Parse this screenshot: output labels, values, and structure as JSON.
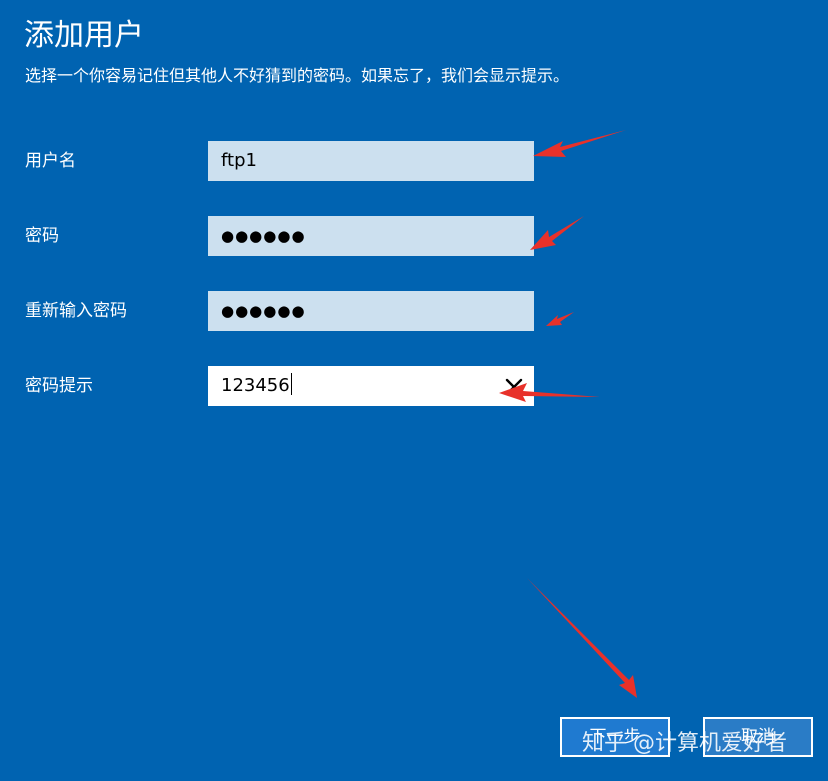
{
  "page": {
    "title": "添加用户",
    "subtitle": "选择一个你容易记住但其他人不好猜到的密码。如果忘了，我们会显示提示。"
  },
  "form": {
    "username": {
      "label": "用户名",
      "value": "ftp1"
    },
    "password": {
      "label": "密码",
      "value": "●●●●●●"
    },
    "confirm_password": {
      "label": "重新输入密码",
      "value": "●●●●●●"
    },
    "password_hint": {
      "label": "密码提示",
      "value": "123456"
    }
  },
  "buttons": {
    "next": "下一步",
    "cancel": "取消"
  },
  "watermark": "知乎 @计算机爱好者",
  "colors": {
    "background": "#0063b1",
    "field_background": "#cce0ef",
    "annotation_arrow": "#e8312a"
  },
  "icons": {
    "clear": "close-icon"
  }
}
